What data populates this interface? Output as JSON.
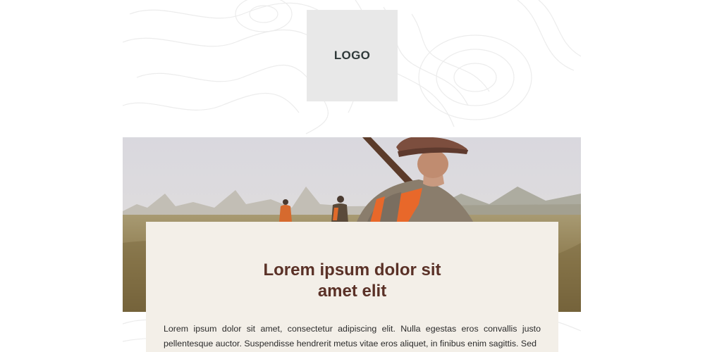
{
  "logo": {
    "label": "LOGO"
  },
  "hero": {
    "image": "hunter-in-field-photo"
  },
  "article": {
    "headline_line1": "Lorem ipsum dolor sit",
    "headline_line2": "amet elit",
    "body": "Lorem ipsum dolor sit amet, consectetur adipiscing elit. Nulla egestas eros convallis justo pellentesque auctor. Suspendisse hendrerit metus vitae eros aliquet, in finibus enim sagittis. Sed"
  },
  "colors": {
    "card_background": "#f3efe8",
    "headline": "#5a3127",
    "logo_placeholder": "#e8e8e8",
    "vest_orange": "#e8682a"
  }
}
